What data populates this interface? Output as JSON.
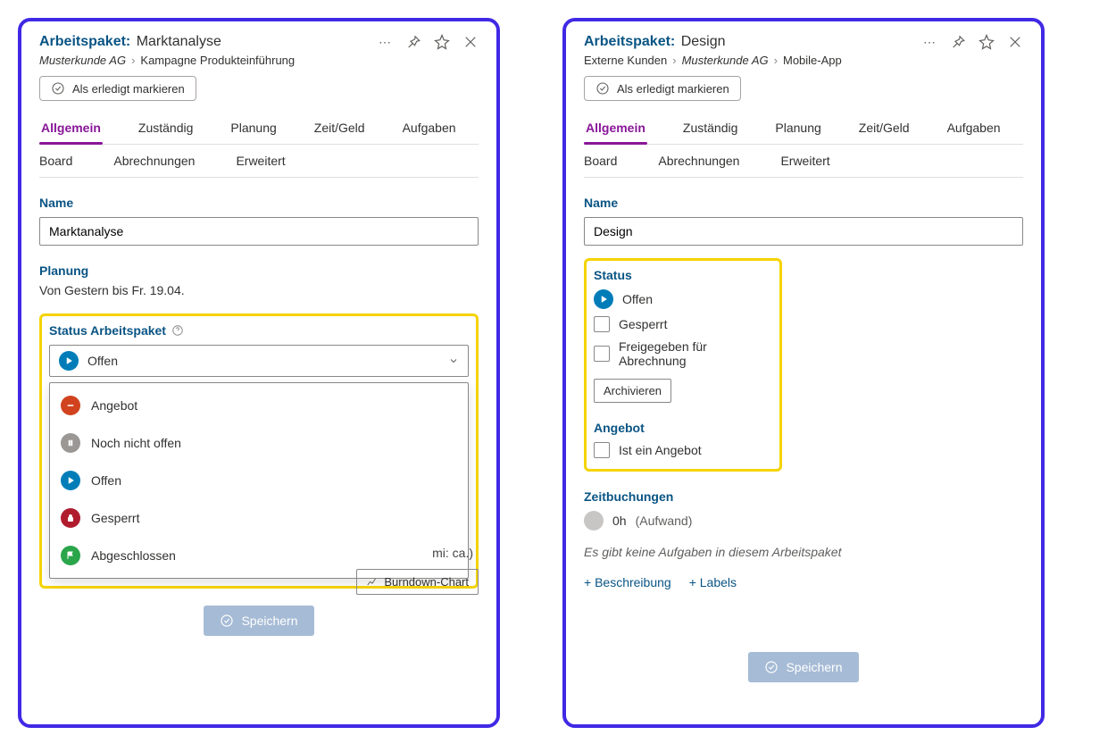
{
  "left": {
    "title_label": "Arbeitspaket:",
    "title_value": "Marktanalyse",
    "breadcrumb": [
      {
        "text": "Musterkunde AG",
        "italic": true
      },
      {
        "text": "Kampagne Produkteinführung",
        "italic": false
      }
    ],
    "mark_done": "Als erledigt markieren",
    "tabs": [
      "Allgemein",
      "Zuständig",
      "Planung",
      "Zeit/Geld",
      "Aufgaben"
    ],
    "subtabs": [
      "Board",
      "Abrechnungen",
      "Erweitert"
    ],
    "name_label": "Name",
    "name_value": "Marktanalyse",
    "planung_label": "Planung",
    "planung_value": "Von Gestern bis Fr. 19.04.",
    "status_label": "Status Arbeitspaket",
    "status_selected": "Offen",
    "status_options": [
      {
        "key": "angebot",
        "label": "Angebot",
        "cls": "sd-angebot",
        "icon": "dash"
      },
      {
        "key": "noch",
        "label": "Noch nicht offen",
        "cls": "sd-noch",
        "icon": "pause"
      },
      {
        "key": "offen",
        "label": "Offen",
        "cls": "sd-offen",
        "icon": "play"
      },
      {
        "key": "gesperrt",
        "label": "Gesperrt",
        "cls": "sd-gesperrt",
        "icon": "lock"
      },
      {
        "key": "abg",
        "label": "Abgeschlossen",
        "cls": "sd-abg",
        "icon": "flag"
      }
    ],
    "behind_text": "mi: ca.)",
    "burndown": "Burndown-Chart",
    "save": "Speichern"
  },
  "right": {
    "title_label": "Arbeitspaket:",
    "title_value": "Design",
    "breadcrumb": [
      {
        "text": "Externe Kunden",
        "italic": false
      },
      {
        "text": "Musterkunde AG",
        "italic": true
      },
      {
        "text": "Mobile-App",
        "italic": false
      }
    ],
    "mark_done": "Als erledigt markieren",
    "tabs": [
      "Allgemein",
      "Zuständig",
      "Planung",
      "Zeit/Geld",
      "Aufgaben"
    ],
    "subtabs": [
      "Board",
      "Abrechnungen",
      "Erweitert"
    ],
    "name_label": "Name",
    "name_value": "Design",
    "status_label": "Status",
    "status_current": "Offen",
    "chk_gesperrt": "Gesperrt",
    "chk_freigegeben": "Freigegeben für Abrechnung",
    "archive": "Archivieren",
    "angebot_label": "Angebot",
    "angebot_chk": "Ist ein Angebot",
    "zeit_label": "Zeitbuchungen",
    "zeit_hours": "0h",
    "zeit_note": "(Aufwand)",
    "empty_tasks": "Es gibt keine Aufgaben in diesem Arbeitspaket",
    "add_desc": "+ Beschreibung",
    "add_labels": "+ Labels",
    "save": "Speichern"
  }
}
